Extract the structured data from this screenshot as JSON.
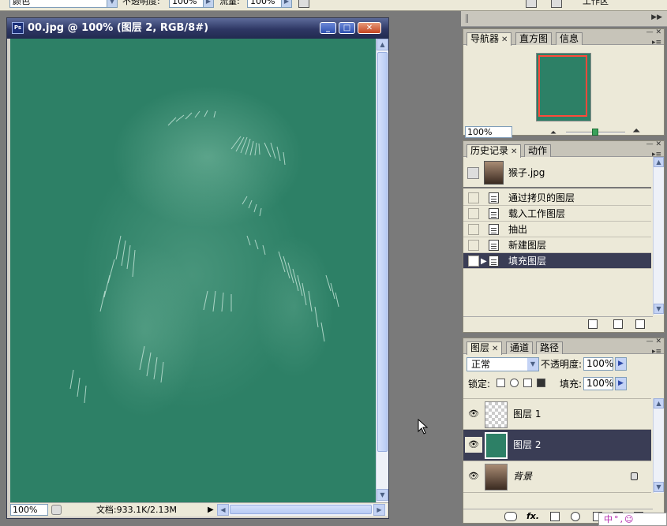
{
  "options_bar": {
    "mode_value": "颜色",
    "opacity_label": "不透明度:",
    "opacity_value": "100%",
    "flow_label": "流量:",
    "flow_value": "100%",
    "workspace_label": "工作区"
  },
  "document": {
    "title": "00.jpg @ 100% (图层 2, RGB/8#)",
    "canvas_color": "#2d8066",
    "zoom": "100%",
    "doc_size": "文档:933.1K/2.13M",
    "menu_arrow": "▶"
  },
  "navigator": {
    "tabs": [
      {
        "label": "导航器",
        "closable": true
      },
      {
        "label": "直方图",
        "closable": false
      },
      {
        "label": "信息",
        "closable": false
      }
    ],
    "zoom": "100%"
  },
  "history": {
    "tabs": [
      {
        "label": "历史记录",
        "closable": true
      },
      {
        "label": "动作",
        "closable": false
      }
    ],
    "snapshot": "猴子.jpg",
    "states": [
      {
        "label": "通过拷贝的图层"
      },
      {
        "label": "载入工作图层"
      },
      {
        "label": "抽出"
      },
      {
        "label": "新建图层"
      },
      {
        "label": "填充图层"
      }
    ]
  },
  "layers": {
    "tabs": [
      {
        "label": "图层",
        "closable": true
      },
      {
        "label": "通道",
        "closable": false
      },
      {
        "label": "路径",
        "closable": false
      }
    ],
    "blend_mode": "正常",
    "opacity_label": "不透明度:",
    "opacity_value": "100%",
    "lock_label": "锁定:",
    "fill_label": "填充:",
    "fill_value": "100%",
    "items": [
      {
        "name": "图层 1"
      },
      {
        "name": "图层 2"
      },
      {
        "name": "背景"
      }
    ],
    "fx_label": "fx."
  },
  "ime": {
    "text": "中°,☺"
  },
  "colors": {
    "accent_selected": "#3a3d55",
    "titlebar": "#2e3764",
    "nav_view_box": "#ff4a3a"
  }
}
